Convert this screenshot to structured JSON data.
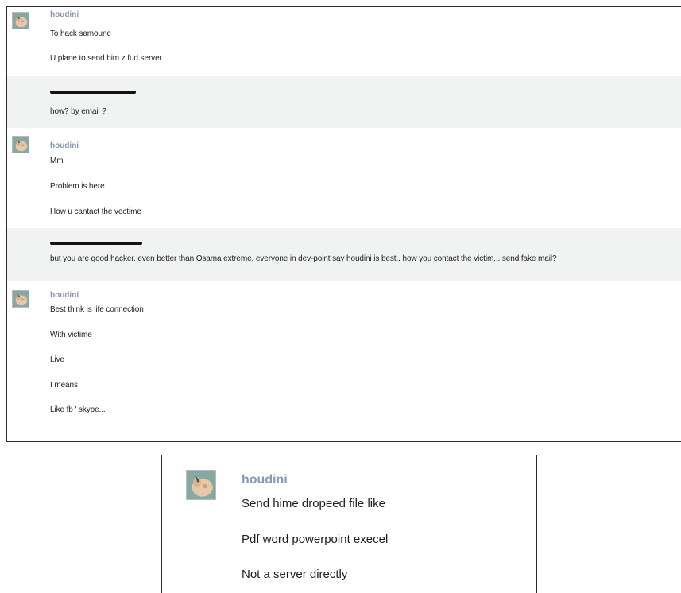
{
  "chat_log": {
    "groups": [
      {
        "sender": "houdini",
        "has_avatar": true,
        "redacted": false,
        "messages": [
          "To hack samoune",
          "U plane to send him z fud server"
        ]
      },
      {
        "sender": "",
        "has_avatar": false,
        "redacted": true,
        "messages": [
          "how? by email ?"
        ]
      },
      {
        "sender": "houdini",
        "has_avatar": true,
        "redacted": false,
        "messages": [
          "Mm",
          "Problem is here",
          "How u cantact the vectime"
        ]
      },
      {
        "sender": "",
        "has_avatar": false,
        "redacted": true,
        "messages": [
          "but you are good hacker. even better than Osama extreme, everyone in dev-point say houdini is best.. how you contact the victim....send fake mail?"
        ]
      },
      {
        "sender": "houdini",
        "has_avatar": true,
        "redacted": false,
        "messages": [
          "Best think is life connection",
          "With victime",
          "Live",
          "I means",
          "Like fb ' skype..."
        ]
      }
    ]
  },
  "zoom_panel": {
    "sender": "houdini",
    "messages": [
      "Send hime dropeed file like",
      "Pdf word powerpoint execel",
      "Not a server directly"
    ]
  },
  "colors": {
    "username": "#8a97b1",
    "gray_band": "#f1f2f2",
    "border": "#2b2b2b"
  },
  "icons": {
    "avatar": "user-avatar-icon",
    "redaction": "redaction-bar"
  }
}
